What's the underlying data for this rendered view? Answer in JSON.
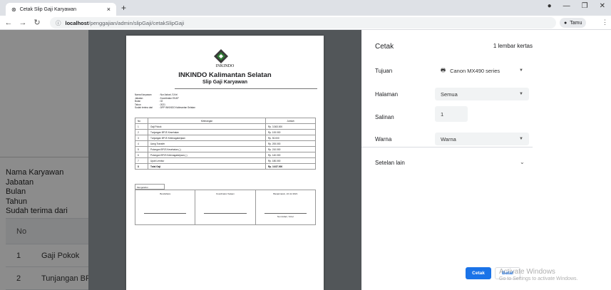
{
  "browser": {
    "tab_title": "Cetak Slip Gaji Karyawan",
    "tab_close": "×",
    "new_tab": "+",
    "url_host": "localhost",
    "url_path": "/penggajian/admin/slipGaji/cetakSlipGaji",
    "profile_label": "Tamu"
  },
  "background": {
    "fields": [
      "Nama Karyawan",
      "Jabatan",
      "Bulan",
      "Tahun",
      "Sudah terima dari"
    ],
    "table_header_no": "No",
    "rows": [
      {
        "no": "1",
        "label": "Gaji Pokok"
      },
      {
        "no": "2",
        "label": "Tunjangan BP"
      }
    ]
  },
  "slip": {
    "org": "INKINDO",
    "title": "INKINDO Kalimantan Selatan",
    "subtitle": "Slip Gaji Karyawan",
    "info": [
      {
        "k": "Nama Karyawan",
        "v": ": Nur Ashari, S.Kel"
      },
      {
        "k": "Jabatan",
        "v": ": Koordinator EKAP"
      },
      {
        "k": "Bulan",
        "v": ": 02"
      },
      {
        "k": "Tahun",
        "v": ": 2021"
      },
      {
        "k": "Sudah terima dari",
        "v": ": DPP INKINDO Kalimantan Selatan"
      }
    ],
    "table_head": {
      "no": "No",
      "desc": "Keterangan",
      "amount": "Jumlah"
    },
    "rows": [
      {
        "no": "1",
        "desc": "Gaji Pokok",
        "amount": "Rp. 3.363.000"
      },
      {
        "no": "2",
        "desc": "Tunjangan BPJS Kesehatan",
        "amount": "Rp. 100.000"
      },
      {
        "no": "3",
        "desc": "Tunjangan BPJS Ketenagakerjaan",
        "amount": "Rp. 50.000"
      },
      {
        "no": "4",
        "desc": "Uang Transfer",
        "amount": "Rp. 200.000"
      },
      {
        "no": "5",
        "desc": "Potongan BPJS Kesehatan (-)",
        "amount": "Rp. 210.000"
      },
      {
        "no": "6",
        "desc": "Potongan BPJS Ketenagakerjaan (-)",
        "amount": "Rp. 140.000"
      },
      {
        "no": "7",
        "desc": "Upah Lembur",
        "amount": "Rp. 180.000"
      },
      {
        "no": "8",
        "desc": "Total Gaji",
        "amount": "Rp. 3.637.000"
      }
    ],
    "sig_tag": "Mengetahui",
    "sigs": [
      {
        "role": "Bendahara",
        "name": ""
      },
      {
        "role": "Koordinator Sekjen",
        "name": ""
      },
      {
        "role": "Banjarmasin, 24 Jul 2021",
        "name": "Nur Ashari, S.Kel"
      }
    ]
  },
  "print_panel": {
    "title": "Cetak",
    "sheets": "1 lembar kertas",
    "destination_label": "Tujuan",
    "destination_value": "Canon MX490 series",
    "pages_label": "Halaman",
    "pages_value": "Semua",
    "copies_label": "Salinan",
    "copies_value": "1",
    "color_label": "Warna",
    "color_value": "Warna",
    "more_settings": "Setelan lain",
    "print_button": "Cetak",
    "cancel_button": "Batal"
  },
  "watermark": {
    "line1": "Activate Windows",
    "line2": "Go to Settings to activate Windows."
  },
  "colors": {
    "accent": "#1a73e8"
  }
}
